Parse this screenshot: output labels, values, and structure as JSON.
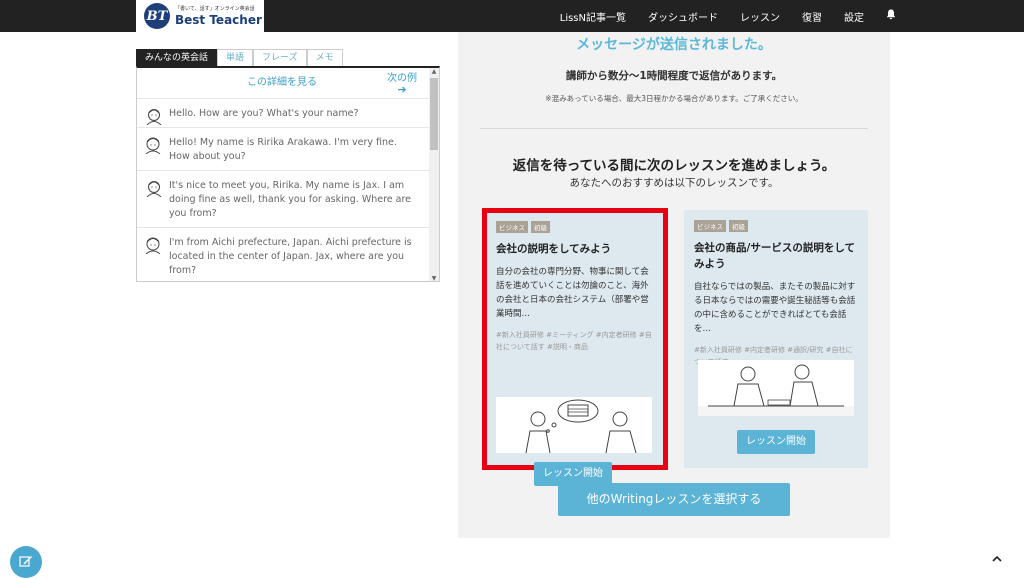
{
  "header": {
    "logo_tagline": "「書いて、話す」オンライン英会話",
    "logo_name": "Best Teacher",
    "logo_mark": "BT",
    "nav": [
      "LissN記事一覧",
      "ダッシュボード",
      "レッスン",
      "復習",
      "設定"
    ],
    "bell_icon": "bell-icon"
  },
  "chat": {
    "tabs": [
      "みんなの英会話",
      "単語",
      "フレーズ",
      "メモ"
    ],
    "detail_link": "この詳細を見る",
    "next_link": "次の例",
    "next_arrow": "➔",
    "messages": [
      {
        "text": "Hello. How are you? What's your name?",
        "speaker": "teacher"
      },
      {
        "text": "Hello! My name is Ririka Arakawa. I'm very fine. How about you?",
        "speaker": "student"
      },
      {
        "text": "It's nice to meet you, Ririka. My name is Jax. I am doing fine as well, thank you for asking. Where are you from?",
        "speaker": "teacher"
      },
      {
        "text": "I'm from Aichi prefecture, Japan. Aichi prefecture is located in the center of Japan. Jax, where are you from?",
        "speaker": "student"
      }
    ]
  },
  "main": {
    "sent_title": "メッセージが送信されました。",
    "reply_text": "講師から数分〜1時間程度で返信があります。",
    "note_text": "※混みあっている場合、最大3日程かかる場合があります。ご了承ください。",
    "next_title": "返信を待っている間に次のレッスンを進めましょう。",
    "next_sub": "あなたへのおすすめは以下のレッスンです。",
    "cards": [
      {
        "badges": [
          "ビジネス",
          "初級"
        ],
        "title": "会社の説明をしてみよう",
        "desc": "自分の会社の専門分野、物事に関して会話を進めていくことは勿論のこと、海外の会社と日本の会社システム（部署や営業時間…",
        "tags": "#新入社員研修 #ミーティング #内定者研修 #自社について話す #説明・商品",
        "button": "レッスン開始"
      },
      {
        "badges": [
          "ビジネス",
          "初級"
        ],
        "title": "会社の商品/サービスの説明をしてみよう",
        "desc": "自社ならではの製品、またその製品に対する日本ならではの需要や誕生秘話等も会話の中に含めることができればとても会話を…",
        "tags": "#新入社員研修 #内定者研修 #通訳/研究 #自社について話す",
        "button": "レッスン開始"
      }
    ],
    "other_button": "他のWritingレッスンを選択する"
  },
  "fab_icon": "edit-icon",
  "top_icon": "chevron-up-icon",
  "colors": {
    "accent": "#5bb3d6",
    "highlight": "#e60012",
    "nav": "#222222"
  }
}
